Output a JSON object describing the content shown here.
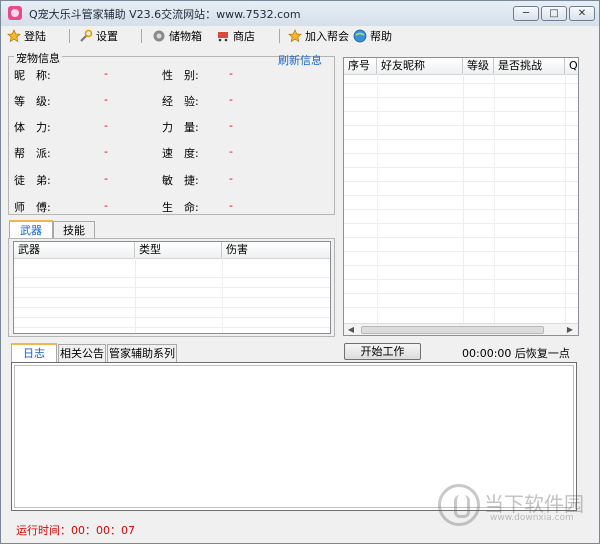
{
  "title_bar": {
    "title": "Q宠大乐斗管家辅助 V23.6交流网站：www.7532.com",
    "buttons": [
      "─",
      "□",
      "✕"
    ]
  },
  "toolbar": {
    "items": [
      "登陆",
      "设置",
      "储物箱",
      "商店",
      "加入帮会",
      "帮助"
    ]
  },
  "pet_info": {
    "group_title": "宠物信息",
    "refresh_label": "刷新信息",
    "left": [
      {
        "label": "昵　称:",
        "value": "-"
      },
      {
        "label": "等　级:",
        "value": "-"
      },
      {
        "label": "体　力:",
        "value": "-"
      },
      {
        "label": "帮　派:",
        "value": "-"
      },
      {
        "label": "徒　弟:",
        "value": "-"
      },
      {
        "label": "师　傅:",
        "value": "-"
      }
    ],
    "right": [
      {
        "label": "性　别:",
        "value": "-"
      },
      {
        "label": "经　验:",
        "value": "-"
      },
      {
        "label": "力　量:",
        "value": "-"
      },
      {
        "label": "速　度:",
        "value": "-"
      },
      {
        "label": "敏　捷:",
        "value": "-"
      },
      {
        "label": "生　命:",
        "value": "-"
      }
    ]
  },
  "equip_tabs": {
    "tabs": [
      "武器",
      "技能"
    ],
    "columns": [
      "武器",
      "类型",
      "伤害"
    ]
  },
  "friends": {
    "columns": [
      "序号",
      "好友昵称",
      "等级",
      "是否挑战",
      "QQ"
    ]
  },
  "scroll": {
    "left_arrow": "◀",
    "right_arrow": "▶"
  },
  "actions": {
    "start_label": "开始工作",
    "recover_text": "00:00:00 后恢复一点"
  },
  "log_tabs": {
    "tabs": [
      "日志",
      "相关公告",
      "管家辅助系列"
    ]
  },
  "status": {
    "runtime": "运行时间：00：00：07"
  },
  "watermark": {
    "title": "当下软件园",
    "url": "www.downxia.com"
  },
  "colors": {
    "accent_red": "#e30000",
    "link_blue": "#1e64c8",
    "tab_active": "#1560d0"
  }
}
